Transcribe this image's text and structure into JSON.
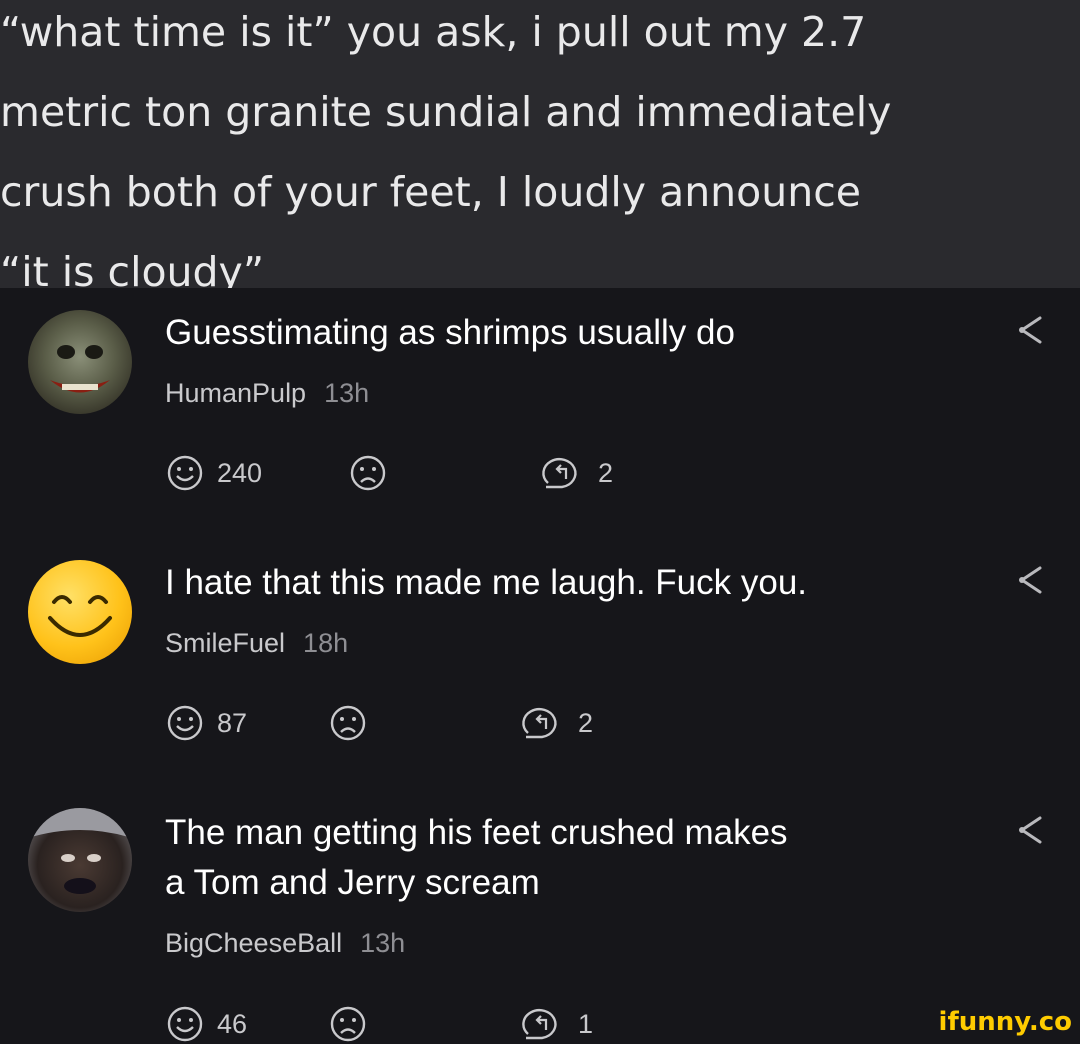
{
  "post": {
    "text": "“what time is it” you ask, i pull out my 2.7\nmetric ton granite sundial and immediately\ncrush both of your feet, I loudly announce\n“it is cloudy”"
  },
  "comments": [
    {
      "text": "Guesstimating as shrimps usually do",
      "user": "HumanPulp",
      "time": "13h",
      "likes": "240",
      "replies": "2"
    },
    {
      "text": "I hate that this made me laugh. Fuck you.",
      "user": "SmileFuel",
      "time": "18h",
      "likes": "87",
      "replies": "2"
    },
    {
      "text": "The man getting his feet crushed makes\na Tom and Jerry scream",
      "user": "BigCheeseBall",
      "time": "13h",
      "likes": "46",
      "replies": "1"
    }
  ],
  "watermark": "ifunny.co",
  "colors": {
    "post_bg": "#2a2a2e",
    "comments_bg": "#16161a",
    "meta": "#8e8e93",
    "watermark": "#ffcc00"
  }
}
